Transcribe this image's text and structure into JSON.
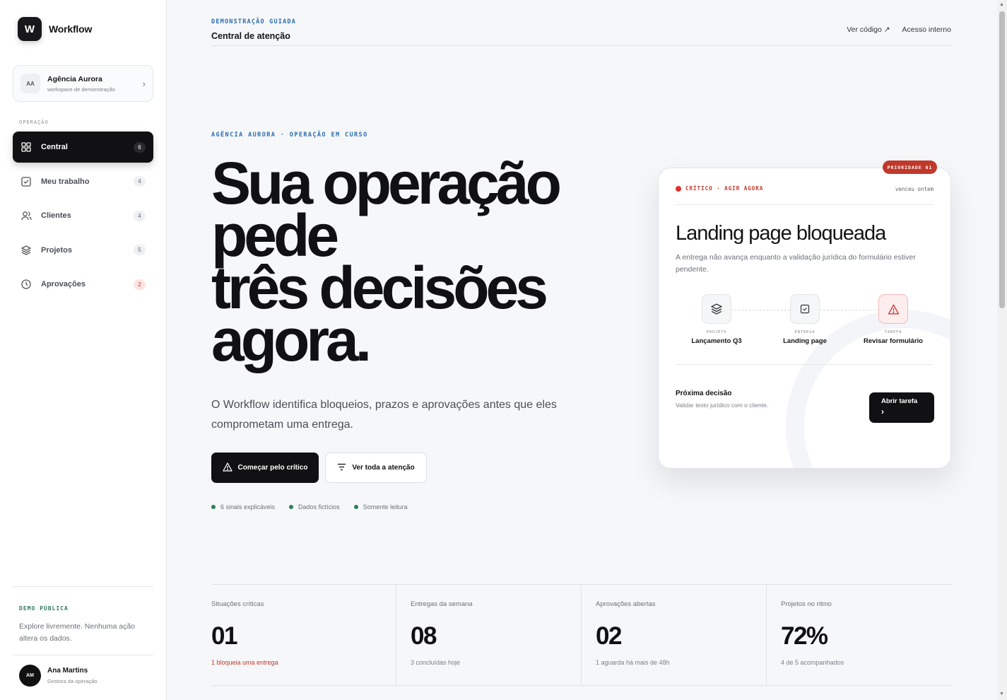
{
  "brand": {
    "logo": "W",
    "name": "Workflow"
  },
  "workspace": {
    "avatar": "AA",
    "name": "Agência Aurora",
    "subtitle": "workspace de demonstração"
  },
  "sidebar": {
    "section": "OPERAÇÃO",
    "items": [
      {
        "label": "Central",
        "count": "6",
        "icon": "grid-icon",
        "active": true
      },
      {
        "label": "Meu trabalho",
        "count": "4",
        "icon": "check-square-icon"
      },
      {
        "label": "Clientes",
        "count": "4",
        "icon": "users-icon"
      },
      {
        "label": "Projetos",
        "count": "5",
        "icon": "layers-icon"
      },
      {
        "label": "Aprovações",
        "count": "2",
        "icon": "clock-icon",
        "alert": true
      }
    ],
    "demo_label": "DEMO PÚBLICA",
    "demo_text": "Explore livremente. Nenhuma ação altera os dados.",
    "user": {
      "avatar": "AM",
      "name": "Ana Martins",
      "role": "Gestora da operação"
    }
  },
  "header": {
    "kicker": "DEMONSTRAÇÃO GUIADA",
    "title": "Central de atenção",
    "links": [
      "Ver código ↗",
      "Acesso interno"
    ]
  },
  "hero": {
    "kicker": "AGÊNCIA AURORA · OPERAÇÃO EM CURSO",
    "title_lines": [
      "Sua operação",
      "pede",
      "três decisões",
      "agora."
    ],
    "subtitle": "O Workflow identifica bloqueios, prazos e aprovações antes que eles comprometam uma entrega.",
    "primary_button": "Começar pelo crítico",
    "secondary_button": "Ver toda a atenção",
    "signals": [
      "6 sinais explicáveis",
      "Dados fictícios",
      "Somente leitura"
    ]
  },
  "card": {
    "priority": "PRIORIDADE 01",
    "status": "CRÍTICO · AGIR AGORA",
    "due": "venceu ontem",
    "title": "Landing page bloqueada",
    "description": "A entrega não avança enquanto a validação jurídica do formulário estiver pendente.",
    "steps": [
      {
        "label": "PROJETO",
        "value": "Lançamento Q3",
        "icon": "layers-icon"
      },
      {
        "label": "ENTREGA",
        "value": "Landing page",
        "icon": "check-square-icon"
      },
      {
        "label": "TAREFA",
        "value": "Revisar formulário",
        "icon": "warning-icon"
      }
    ],
    "next_label": "Próxima decisão",
    "next_text": "Validar texto jurídico com o cliente.",
    "open_button": "Abrir tarefa"
  },
  "stats": [
    {
      "label": "Situações críticas",
      "value": "01",
      "note": "1 bloqueia uma entrega",
      "note_alert": true
    },
    {
      "label": "Entregas da semana",
      "value": "08",
      "note": "3 concluídas hoje"
    },
    {
      "label": "Aprovações abertas",
      "value": "02",
      "note": "1 aguarda há mais de 48h"
    },
    {
      "label": "Projetos no ritmo",
      "value": "72%",
      "note": "4 de 5 acompanhados"
    }
  ],
  "colors": {
    "accent_blue": "#2b6cb0",
    "alert_red": "#c0392b",
    "ok_green": "#2e7d5b",
    "ink": "#111113"
  }
}
